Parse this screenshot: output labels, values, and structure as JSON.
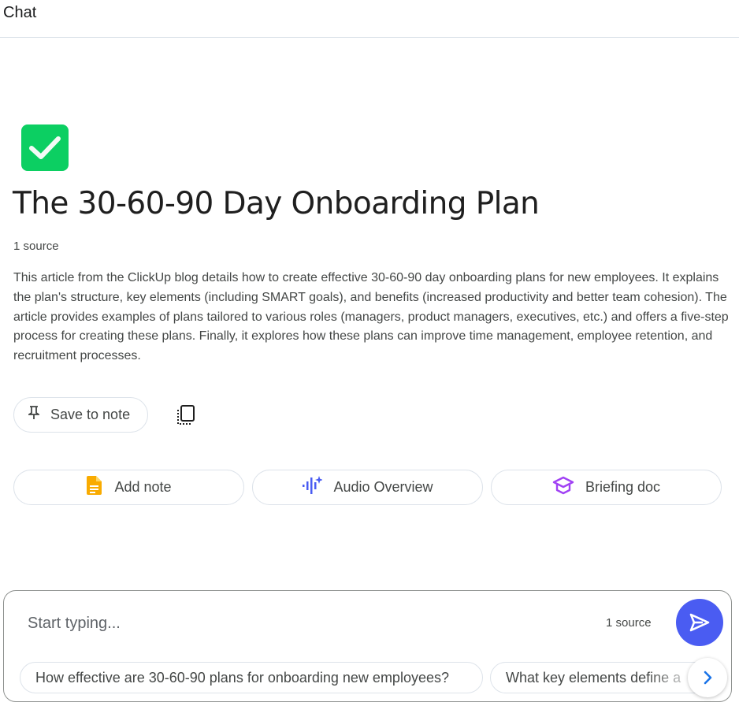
{
  "header": {
    "title": "Chat"
  },
  "notebook": {
    "icon": "green-checkmark-icon",
    "title": "The 30-60-90 Day Onboarding Plan",
    "source_count": "1 source",
    "summary": "This article from the ClickUp blog details how to create effective 30-60-90 day onboarding plans for new employees. It explains the plan's structure, key elements (including SMART goals), and benefits (increased productivity and better team cohesion). The article provides examples of plans tailored to various roles (managers, product managers, executives, etc.) and offers a five-step process for creating these plans. Finally, it explores how these plans can improve time management, employee retention, and recruitment processes."
  },
  "summary_actions": {
    "save_to_note": {
      "label": "Save to note",
      "icon": "pin-icon"
    },
    "copy": {
      "icon": "copy-icon"
    }
  },
  "actions": [
    {
      "label": "Add note",
      "icon": "note-icon",
      "color": "#f9ab00"
    },
    {
      "label": "Audio Overview",
      "icon": "audio-waveform-icon",
      "color": "#4a5cf2"
    },
    {
      "label": "Briefing doc",
      "icon": "graduation-cap-icon",
      "color": "#a142f4"
    }
  ],
  "composer": {
    "placeholder": "Start typing...",
    "source_count": "1 source",
    "send_icon": "send-icon",
    "accent": "#4a5cf2",
    "suggestions": [
      "How effective are 30-60-90 plans for onboarding new employees?",
      "What key elements define a"
    ],
    "next_icon": "chevron-right-icon"
  }
}
